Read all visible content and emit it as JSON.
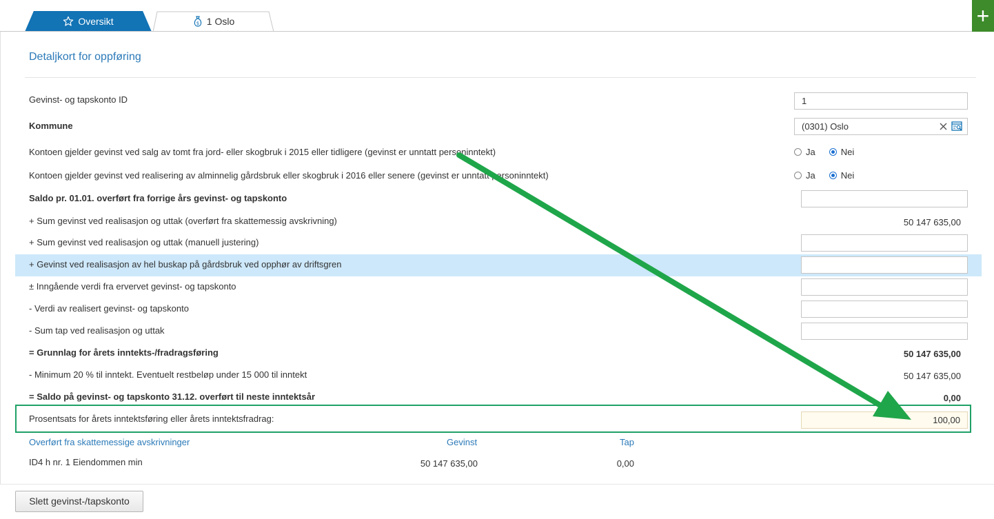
{
  "tabs": [
    {
      "label": "Oversikt",
      "icon": "star-icon",
      "active": true
    },
    {
      "label": "1 Oslo",
      "icon": "money-bag-icon",
      "active": false
    }
  ],
  "add_button": {
    "icon": "plus-icon",
    "color": "#3d8b2a"
  },
  "page": {
    "title": "Detaljkort for oppføring"
  },
  "fields": {
    "account_id": {
      "label": "Gevinst- og tapskonto ID",
      "value": "1"
    },
    "kommune": {
      "label": "Kommune",
      "value": "(0301) Oslo"
    },
    "q1": {
      "label": "Kontoen gjelder gevinst ved salg av tomt fra jord- eller skogbruk i 2015 eller tidligere (gevinst er unntatt personinntekt)",
      "options": [
        "Ja",
        "Nei"
      ],
      "selected": "Nei"
    },
    "q2": {
      "label": "Kontoen gjelder gevinst ved realisering av alminnelig gårdsbruk eller skogbruk i 2016 eller senere (gevinst er unntatt personinntekt)",
      "options": [
        "Ja",
        "Nei"
      ],
      "selected": "Nei"
    }
  },
  "rows": {
    "saldo_start": {
      "label": "Saldo pr. 01.01. overført fra forrige års gevinst- og tapskonto"
    },
    "sum_gevinst_overfort": {
      "label": "+ Sum gevinst ved realisasjon og uttak (overført fra skattemessig avskrivning)",
      "value": "50 147 635,00"
    },
    "sum_gevinst_manuell": {
      "label": "+ Sum gevinst ved realisasjon og uttak (manuell justering)"
    },
    "buskap": {
      "label": "+ Gevinst ved realisasjon av hel buskap på gårdsbruk ved opphør av driftsgren"
    },
    "inngaende": {
      "label": "± Inngående verdi fra ervervet gevinst- og tapskonto"
    },
    "verdi_realisert": {
      "label": "- Verdi av realisert gevinst- og tapskonto"
    },
    "sum_tap": {
      "label": "- Sum tap ved realisasjon og uttak"
    },
    "grunnlag": {
      "label": "= Grunnlag for årets inntekts-/fradragsføring",
      "value": "50 147 635,00"
    },
    "minimum": {
      "label": "- Minimum 20 % til inntekt. Eventuelt restbeløp under 15 000 til inntekt",
      "value": "50 147 635,00"
    },
    "saldo_end": {
      "label": "= Saldo på gevinst- og tapskonto 31.12. overført til neste inntektsår",
      "value": "0,00"
    },
    "prosentsats": {
      "label": "Prosentsats for årets inntektsføring eller årets inntektsfradrag:",
      "value": "100,00"
    }
  },
  "sub_table": {
    "headers": [
      "Overført fra skattemessige avskrivninger",
      "Gevinst",
      "Tap"
    ],
    "rows": [
      {
        "name": "ID4 h nr. 1 Eiendommen min",
        "gevinst": "50 147 635,00",
        "tap": "0,00"
      }
    ]
  },
  "footer": {
    "delete_label": "Slett gevinst-/tapskonto"
  },
  "annotation": {
    "arrow_color": "#1fa64a",
    "box_color": "#1fa067"
  }
}
